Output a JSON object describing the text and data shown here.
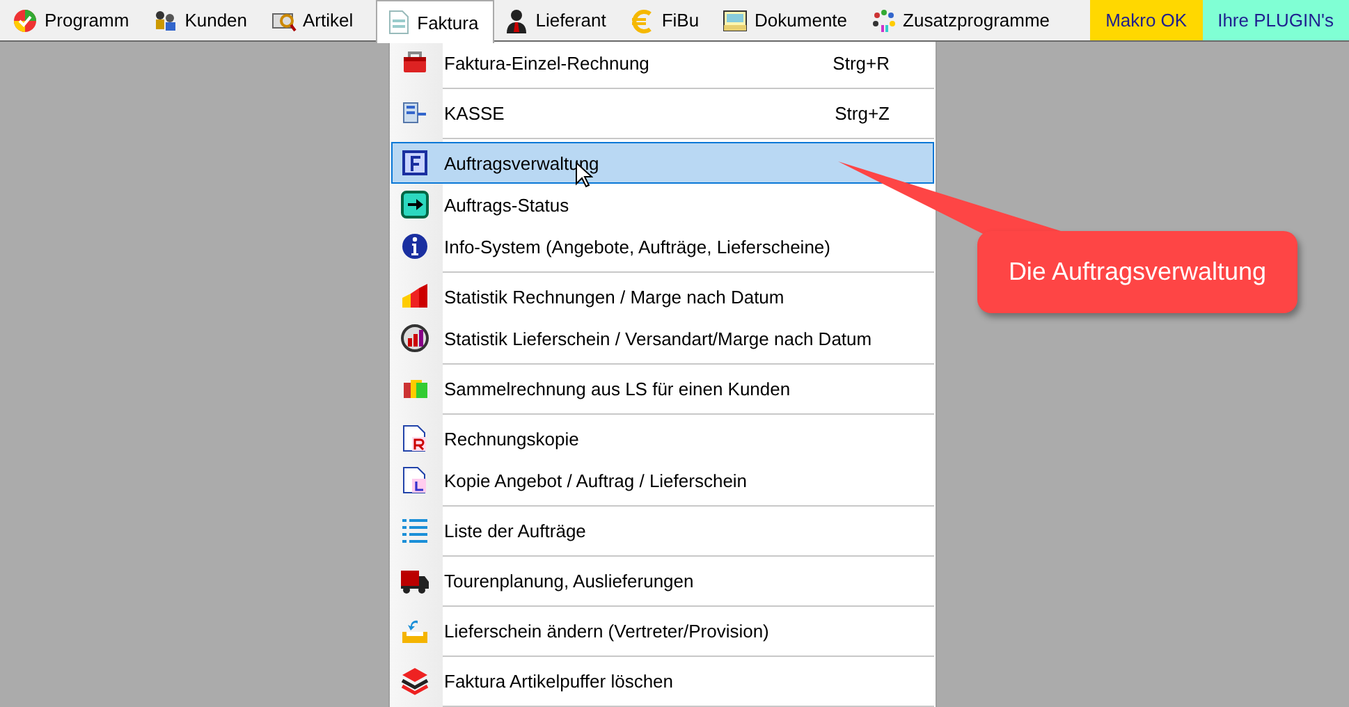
{
  "menubar": [
    {
      "label": "Programm",
      "kind": "menu",
      "selected": false
    },
    {
      "label": "Kunden",
      "kind": "menu",
      "selected": false
    },
    {
      "label": "Artikel",
      "kind": "menu",
      "selected": false
    },
    {
      "label": "Faktura",
      "kind": "menu",
      "selected": true
    },
    {
      "label": "Lieferant",
      "kind": "menu",
      "selected": false
    },
    {
      "label": "FiBu",
      "kind": "menu",
      "selected": false
    },
    {
      "label": "Dokumente",
      "kind": "menu",
      "selected": false
    },
    {
      "label": "Zusatzprogramme",
      "kind": "menu",
      "selected": false
    },
    {
      "label": "Makro OK",
      "kind": "colored",
      "selected": false,
      "color": "#ffd800"
    },
    {
      "label": "Ihre PLUGIN's",
      "kind": "colored",
      "selected": false,
      "color": "#80ffd4"
    }
  ],
  "menu": {
    "groups": [
      [
        {
          "label": "Faktura-Einzel-Rechnung",
          "shortcut": "Strg+R",
          "selected": false
        }
      ],
      [
        {
          "label": "KASSE",
          "shortcut": "Strg+Z",
          "selected": false
        }
      ],
      [
        {
          "label": "Auftragsverwaltung",
          "selected": true
        },
        {
          "label": "Auftrags-Status",
          "selected": false
        },
        {
          "label": "Info-System (Angebote, Aufträge, Lieferscheine)",
          "selected": false
        }
      ],
      [
        {
          "label": "Statistik Rechnungen / Marge nach Datum",
          "selected": false
        },
        {
          "label": "Statistik Lieferschein / Versandart/Marge nach Datum",
          "selected": false
        }
      ],
      [
        {
          "label": "Sammelrechnung aus LS für einen Kunden",
          "selected": false
        }
      ],
      [
        {
          "label": "Rechnungskopie",
          "selected": false
        },
        {
          "label": "Kopie Angebot / Auftrag / Lieferschein",
          "selected": false
        }
      ],
      [
        {
          "label": "Liste der Aufträge",
          "selected": false
        }
      ],
      [
        {
          "label": "Tourenplanung, Auslieferungen",
          "selected": false
        }
      ],
      [
        {
          "label": "Lieferschein ändern (Vertreter/Provision)",
          "selected": false
        }
      ],
      [
        {
          "label": "Faktura Artikelpuffer löschen",
          "selected": false
        }
      ]
    ]
  },
  "callout": {
    "text": "Die Auftragsverwaltung"
  }
}
